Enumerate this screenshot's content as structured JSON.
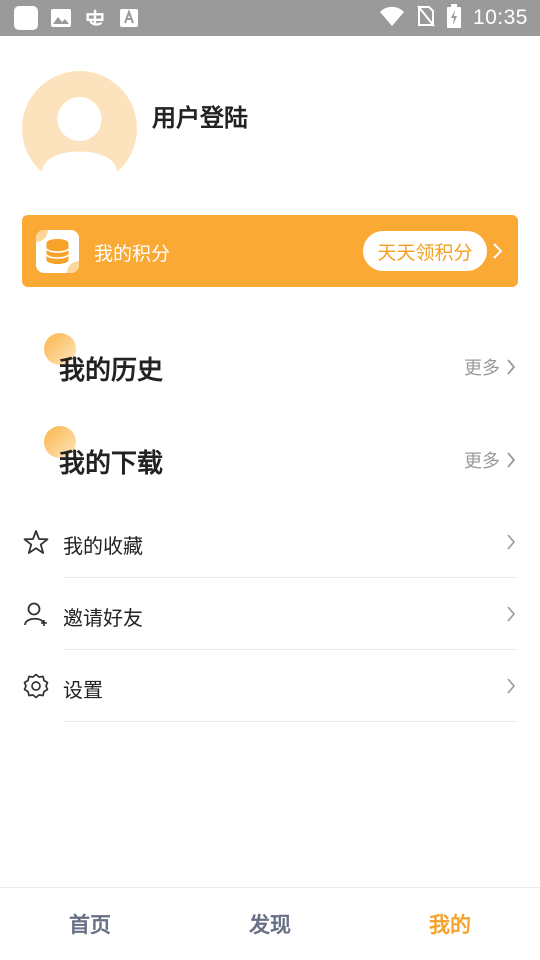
{
  "status_bar": {
    "time": "10:35"
  },
  "profile": {
    "username": "用户登陆"
  },
  "points": {
    "label": "我的积分",
    "button_label": "天天领积分"
  },
  "sections": [
    {
      "title": "我的历史",
      "more_label": "更多"
    },
    {
      "title": "我的下载",
      "more_label": "更多"
    }
  ],
  "menu": [
    {
      "label": "我的收藏",
      "icon": "star-icon"
    },
    {
      "label": "邀请好友",
      "icon": "user-add-icon"
    },
    {
      "label": "设置",
      "icon": "gear-icon"
    }
  ],
  "bottom_nav": [
    {
      "label": "首页",
      "active": false
    },
    {
      "label": "发现",
      "active": false
    },
    {
      "label": "我的",
      "active": true
    }
  ],
  "colors": {
    "accent": "#fba935",
    "active_tab": "#f6a22b",
    "inactive_tab": "#676f84",
    "status_bar": "#9a9a9a",
    "avatar_bg": "#fde3bd"
  }
}
